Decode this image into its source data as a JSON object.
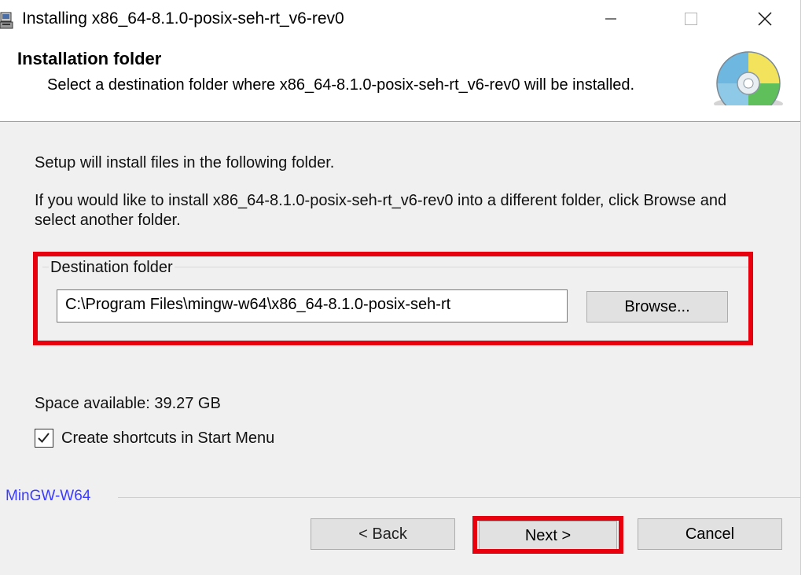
{
  "window": {
    "title": "Installing x86_64-8.1.0-posix-seh-rt_v6-rev0"
  },
  "header": {
    "title": "Installation folder",
    "subtitle": "Select a destination folder where x86_64-8.1.0-posix-seh-rt_v6-rev0 will be installed."
  },
  "content": {
    "intro": "Setup will install files in the following folder.",
    "instructions": "If you would like to install x86_64-8.1.0-posix-seh-rt_v6-rev0 into a different folder, click Browse and select another folder.",
    "destination": {
      "legend": "Destination folder",
      "path": "C:\\Program Files\\mingw-w64\\x86_64-8.1.0-posix-seh-rt",
      "browse_label": "Browse..."
    },
    "space_available": "Space available: 39.27 GB",
    "shortcuts_label": "Create shortcuts in Start Menu",
    "shortcuts_checked": true
  },
  "footer": {
    "brand": "MinGW-W64",
    "back_label": "< Back",
    "next_label": "Next >",
    "cancel_label": "Cancel"
  },
  "colors": {
    "highlight": "#e8000e",
    "brand": "#3b3bff",
    "panel": "#f0f0f0"
  },
  "icons": {
    "app": "installer-icon",
    "header": "cd-disc-icon",
    "minimize": "minimize-icon",
    "maximize": "maximize-icon",
    "close": "close-icon",
    "check": "checkmark-icon"
  }
}
